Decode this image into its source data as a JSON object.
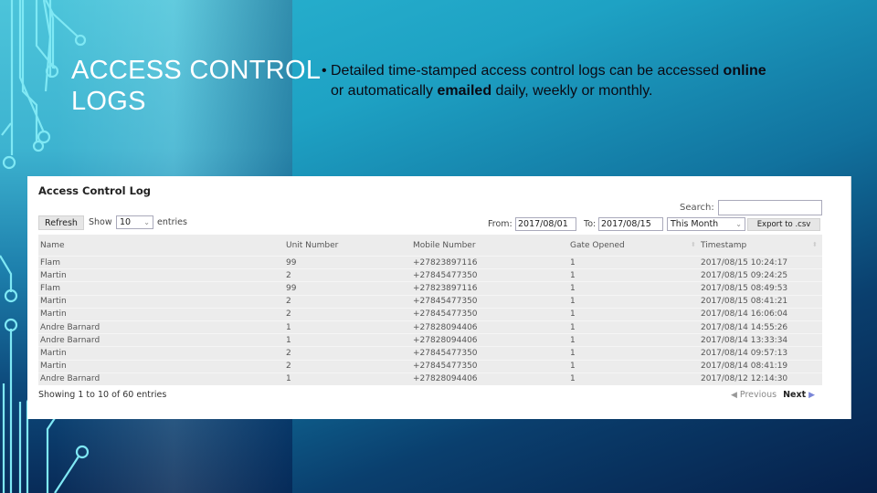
{
  "slide": {
    "title_line1": "ACCESS CONTROL",
    "title_line2": "LOGS",
    "bullet": {
      "part1": "Detailed time-stamped access control logs can be accessed ",
      "bold1": "online",
      "part2": "or automatically ",
      "bold2": "emailed",
      "part3": " daily, weekly or monthly."
    }
  },
  "panel": {
    "title": "Access Control Log",
    "search_label": "Search:",
    "search_value": "",
    "refresh_label": "Refresh",
    "show_label": "Show",
    "entries_label": "entries",
    "page_size": "10",
    "from_label": "From:",
    "from_value": "2017/08/01",
    "to_label": "To:",
    "to_value": "2017/08/15",
    "period": "This Month",
    "export_label": "Export to .csv",
    "columns": [
      "Name",
      "Unit Number",
      "Mobile Number",
      "Gate Opened",
      "Timestamp"
    ],
    "rows": [
      [
        "Flam",
        "99",
        "+27823897116",
        "1",
        "2017/08/15 10:24:17"
      ],
      [
        "Martin",
        "2",
        "+27845477350",
        "1",
        "2017/08/15 09:24:25"
      ],
      [
        "Flam",
        "99",
        "+27823897116",
        "1",
        "2017/08/15 08:49:53"
      ],
      [
        "Martin",
        "2",
        "+27845477350",
        "1",
        "2017/08/15 08:41:21"
      ],
      [
        "Martin",
        "2",
        "+27845477350",
        "1",
        "2017/08/14 16:06:04"
      ],
      [
        "Andre Barnard",
        "1",
        "+27828094406",
        "1",
        "2017/08/14 14:55:26"
      ],
      [
        "Andre Barnard",
        "1",
        "+27828094406",
        "1",
        "2017/08/14 13:33:34"
      ],
      [
        "Martin",
        "2",
        "+27845477350",
        "1",
        "2017/08/14 09:57:13"
      ],
      [
        "Martin",
        "2",
        "+27845477350",
        "1",
        "2017/08/14 08:41:19"
      ],
      [
        "Andre Barnard",
        "1",
        "+27828094406",
        "1",
        "2017/08/12 12:14:30"
      ]
    ],
    "info": "Showing 1 to 10 of 60 entries",
    "previous_label": "Previous",
    "next_label": "Next"
  }
}
